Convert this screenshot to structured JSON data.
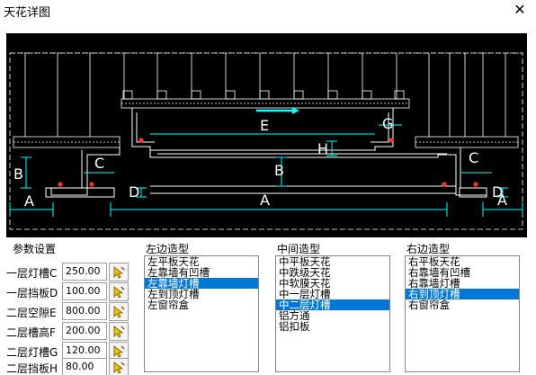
{
  "window": {
    "title": "天花详图"
  },
  "preview": {
    "labels": {
      "A": "A",
      "B": "B",
      "C": "C",
      "D": "D",
      "E": "E",
      "G": "G",
      "H": "H"
    },
    "colors": {
      "background": "#000000",
      "structure": "#ffffff",
      "dimension": "#00ffff",
      "marker": "#ff0000",
      "highlight": "#00ffff"
    }
  },
  "params": {
    "group_label": "参数设置",
    "rows": [
      {
        "label": "一层灯槽C",
        "value": "250.00"
      },
      {
        "label": "一层挡板D",
        "value": "100.00"
      },
      {
        "label": "二层空隙E",
        "value": "800.00"
      },
      {
        "label": "二层槽高F",
        "value": "200.00"
      },
      {
        "label": "二层灯槽G",
        "value": "120.00"
      },
      {
        "label": "二层挡板H",
        "value": "80.00"
      }
    ]
  },
  "left_shape": {
    "group_label": "左边造型",
    "items": [
      "左平板天花",
      "左靠墙有凹槽",
      "左靠墙灯槽",
      "左到顶灯槽",
      "左窗帘盒"
    ],
    "selected_index": 2
  },
  "middle_shape": {
    "group_label": "中间造型",
    "items": [
      "中平板天花",
      "中跌级天花",
      "中软膜天花",
      "中一层灯槽",
      "中二层灯槽",
      "铝方通",
      "铝扣板"
    ],
    "selected_index": 4
  },
  "right_shape": {
    "group_label": "右边造型",
    "items": [
      "右平板天花",
      "右靠墙有凹槽",
      "右靠墙灯槽",
      "右到顶灯槽",
      "右窗帘盒"
    ],
    "selected_index": 3
  }
}
